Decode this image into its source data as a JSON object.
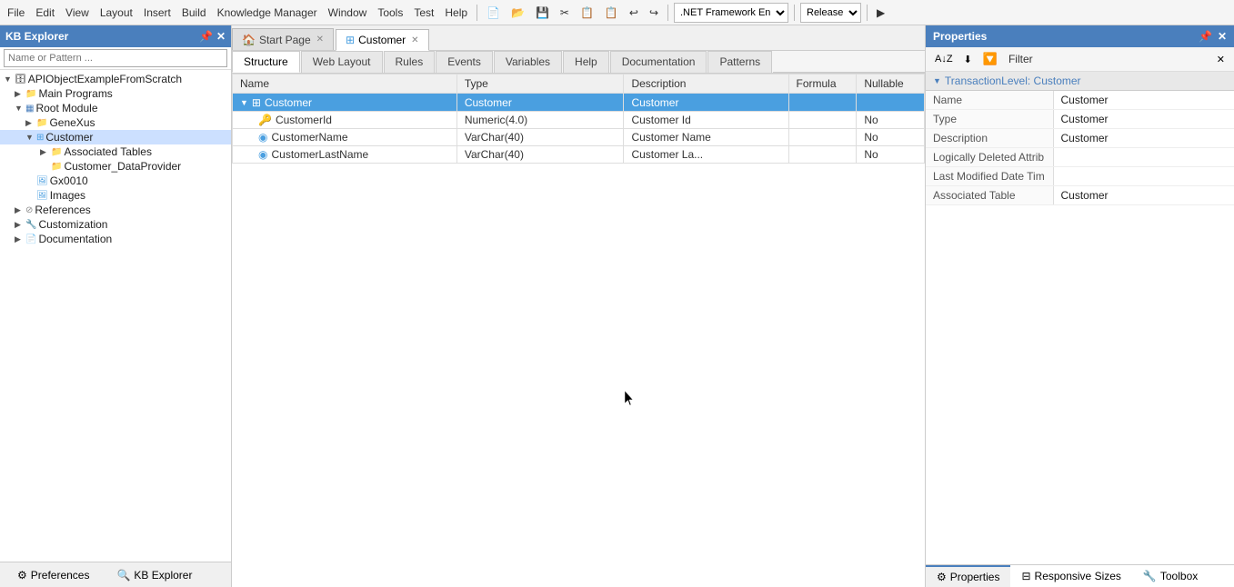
{
  "toolbar": {
    "framework_label": ".NET Framework En",
    "release_label": "Release",
    "run_icon": "▶"
  },
  "kb_explorer": {
    "title": "KB Explorer",
    "search_placeholder": "Name or Pattern ...",
    "tree": [
      {
        "id": "api",
        "label": "APIObjectExampleFromScratch",
        "level": 0,
        "type": "project",
        "expanded": true
      },
      {
        "id": "main",
        "label": "Main Programs",
        "level": 1,
        "type": "folder",
        "expanded": false
      },
      {
        "id": "root",
        "label": "Root Module",
        "level": 1,
        "type": "module",
        "expanded": true
      },
      {
        "id": "genexus",
        "label": "GeneXus",
        "level": 2,
        "type": "folder",
        "expanded": false
      },
      {
        "id": "customer",
        "label": "Customer",
        "level": 2,
        "type": "transaction",
        "expanded": true,
        "selected": false
      },
      {
        "id": "assoc",
        "label": "Associated Tables",
        "level": 3,
        "type": "folder",
        "expanded": false
      },
      {
        "id": "cdp",
        "label": "Customer_DataProvider",
        "level": 3,
        "type": "folder",
        "expanded": false
      },
      {
        "id": "gx0010",
        "label": "Gx0010",
        "level": 2,
        "type": "image",
        "expanded": false
      },
      {
        "id": "images",
        "label": "Images",
        "level": 2,
        "type": "image",
        "expanded": false
      },
      {
        "id": "references",
        "label": "References",
        "level": 1,
        "type": "ref",
        "expanded": false
      },
      {
        "id": "customization",
        "label": "Customization",
        "level": 1,
        "type": "custom",
        "expanded": false
      },
      {
        "id": "documentation",
        "label": "Documentation",
        "level": 1,
        "type": "doc",
        "expanded": false
      }
    ]
  },
  "tabs": [
    {
      "id": "start",
      "label": "Start Page",
      "icon": "🏠",
      "active": false,
      "closable": true
    },
    {
      "id": "customer",
      "label": "Customer",
      "icon": "📋",
      "active": true,
      "closable": true
    }
  ],
  "transaction": {
    "title": "Customer",
    "tabs": [
      "Structure",
      "Web Layout",
      "Rules",
      "Events",
      "Variables",
      "Help",
      "Documentation",
      "Patterns"
    ],
    "active_tab": "Structure",
    "columns": [
      "Name",
      "Type",
      "Description",
      "Formula",
      "Nullable"
    ],
    "rows": [
      {
        "name": "Customer",
        "type": "Customer",
        "description": "Customer",
        "formula": "",
        "nullable": "",
        "level": 0,
        "icon": "transaction",
        "selected": true,
        "expanded": true
      },
      {
        "name": "CustomerId",
        "type": "Numeric(4.0)",
        "description": "Customer Id",
        "formula": "",
        "nullable": "No",
        "level": 1,
        "icon": "key"
      },
      {
        "name": "CustomerName",
        "type": "VarChar(40)",
        "description": "Customer Name",
        "formula": "",
        "nullable": "No",
        "level": 1,
        "icon": "field"
      },
      {
        "name": "CustomerLastName",
        "type": "VarChar(40)",
        "description": "Customer La...",
        "formula": "",
        "nullable": "No",
        "level": 1,
        "icon": "field"
      }
    ]
  },
  "properties": {
    "title": "Properties",
    "filter_label": "Filter",
    "section_label": "TransactionLevel: Customer",
    "items": [
      {
        "name": "Name",
        "value": "Customer"
      },
      {
        "name": "Type",
        "value": "Customer"
      },
      {
        "name": "Description",
        "value": "Customer"
      },
      {
        "name": "Logically Deleted Attrib",
        "value": ""
      },
      {
        "name": "Last Modified Date Tim",
        "value": ""
      },
      {
        "name": "Associated Table",
        "value": "Customer"
      }
    ],
    "footer_tabs": [
      "Properties",
      "Responsive Sizes",
      "Toolbox"
    ]
  },
  "bottom_tabs": [
    {
      "label": "Preferences",
      "icon": "⚙"
    },
    {
      "label": "KB Explorer",
      "icon": "🔍"
    }
  ]
}
